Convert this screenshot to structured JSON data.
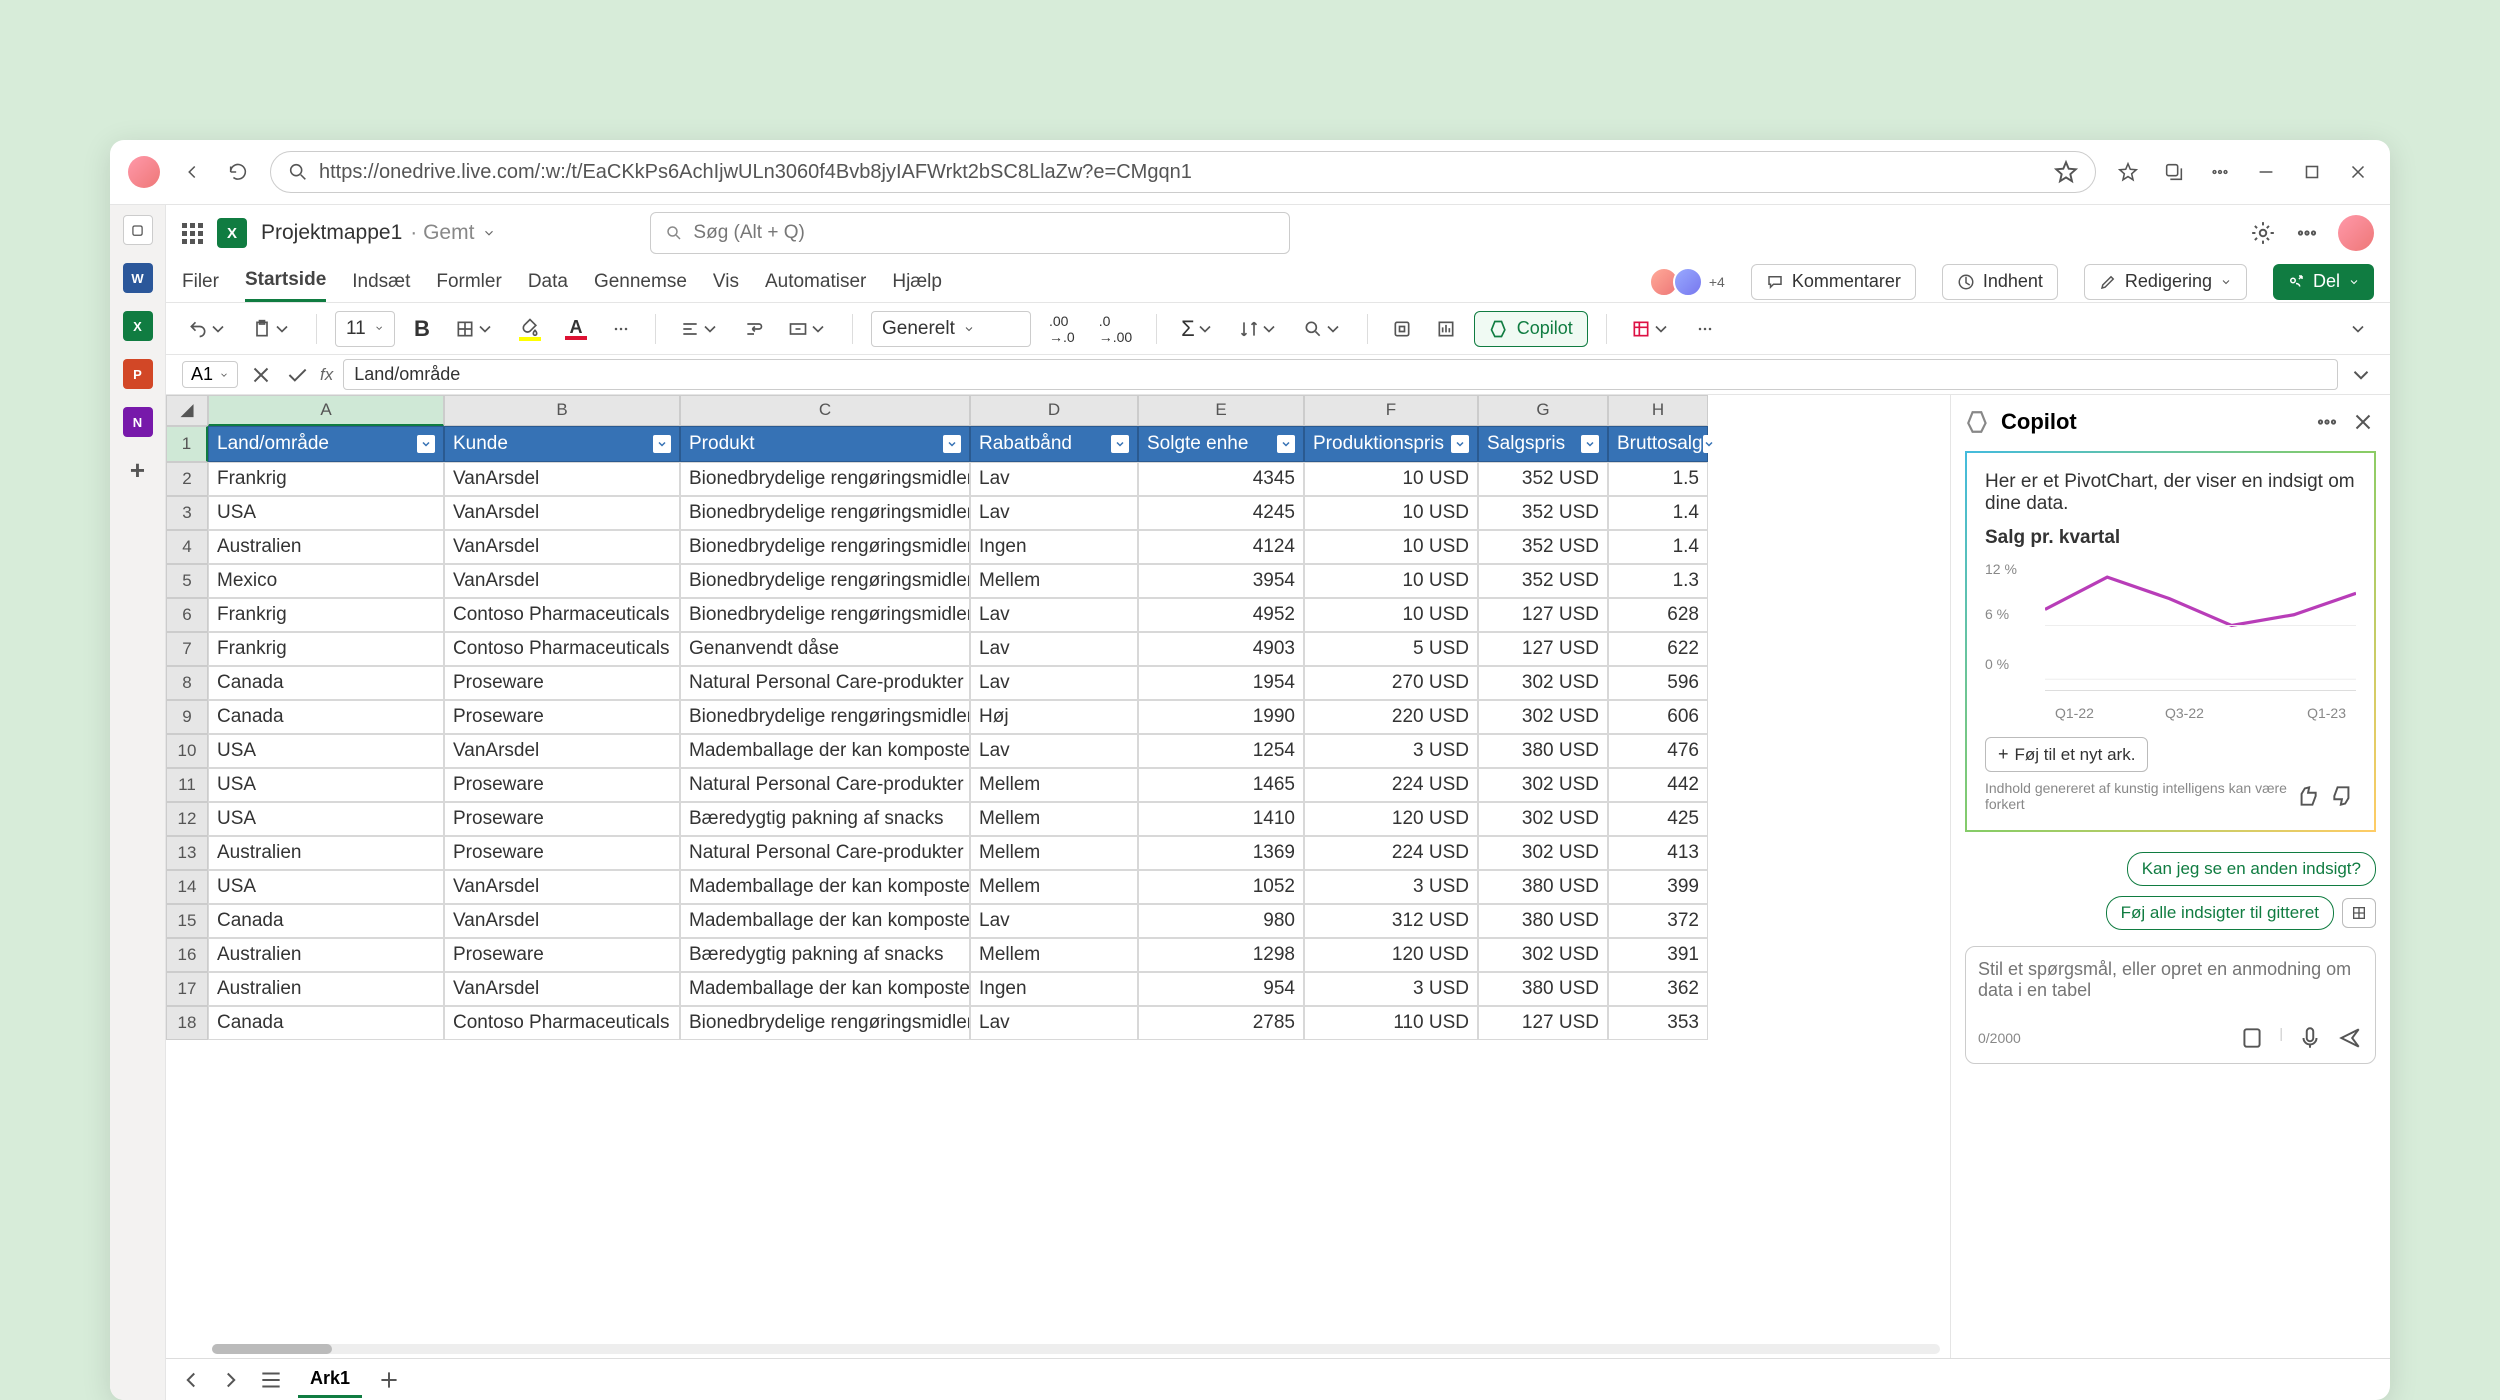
{
  "url": "https://onedrive.live.com/:w:/t/EaCKkPs6AchIjwULn3060f4Bvb8jyIAFWrkt2bSC8LlaZw?e=CMgqn1",
  "doc": {
    "name": "Projektmappe1",
    "state": "Gemt"
  },
  "search_placeholder": "Søg (Alt + Q)",
  "tabs": [
    "Filer",
    "Startside",
    "Indsæt",
    "Formler",
    "Data",
    "Gennemse",
    "Vis",
    "Automatiser",
    "Hjælp"
  ],
  "active_tab": "Startside",
  "more_avatars": "+4",
  "kommentarer": "Kommentarer",
  "indhent": "Indhent",
  "redigering": "Redigering",
  "del": "Del",
  "toolbar": {
    "font_size": "11",
    "number_format": "Generelt",
    "copilot": "Copilot"
  },
  "namebox": "A1",
  "formula": "Land/område",
  "col_headers": [
    "A",
    "B",
    "C",
    "D",
    "E",
    "F",
    "G",
    "H"
  ],
  "table": {
    "headers": [
      "Land/område",
      "Kunde",
      "Produkt",
      "Rabatbånd",
      "Solgte enhe",
      "Produktionspris",
      "Salgspris",
      "Bruttosalg"
    ],
    "rows": [
      [
        "Frankrig",
        "VanArsdel",
        "Bionedbrydelige rengøringsmidler",
        "Lav",
        "4345",
        "10 USD",
        "352 USD",
        "1.5"
      ],
      [
        "USA",
        "VanArsdel",
        "Bionedbrydelige rengøringsmidler",
        "Lav",
        "4245",
        "10 USD",
        "352 USD",
        "1.4"
      ],
      [
        "Australien",
        "VanArsdel",
        "Bionedbrydelige rengøringsmidler",
        "Ingen",
        "4124",
        "10 USD",
        "352 USD",
        "1.4"
      ],
      [
        "Mexico",
        "VanArsdel",
        "Bionedbrydelige rengøringsmidler",
        "Mellem",
        "3954",
        "10 USD",
        "352 USD",
        "1.3"
      ],
      [
        "Frankrig",
        "Contoso Pharmaceuticals",
        "Bionedbrydelige rengøringsmidler",
        "Lav",
        "4952",
        "10 USD",
        "127 USD",
        "628"
      ],
      [
        "Frankrig",
        "Contoso Pharmaceuticals",
        "Genanvendt dåse",
        "Lav",
        "4903",
        "5 USD",
        "127 USD",
        "622"
      ],
      [
        "Canada",
        "Proseware",
        "Natural Personal Care-produkter",
        "Lav",
        "1954",
        "270 USD",
        "302 USD",
        "596"
      ],
      [
        "Canada",
        "Proseware",
        "Bionedbrydelige rengøringsmidler",
        "Høj",
        "1990",
        "220 USD",
        "302 USD",
        "606"
      ],
      [
        "USA",
        "VanArsdel",
        "Mademballage der kan komposter",
        "Lav",
        "1254",
        "3 USD",
        "380 USD",
        "476"
      ],
      [
        "USA",
        "Proseware",
        "Natural Personal Care-produkter",
        "Mellem",
        "1465",
        "224 USD",
        "302 USD",
        "442"
      ],
      [
        "USA",
        "Proseware",
        "Bæredygtig pakning af snacks",
        "Mellem",
        "1410",
        "120 USD",
        "302 USD",
        "425"
      ],
      [
        "Australien",
        "Proseware",
        "Natural Personal Care-produkter",
        "Mellem",
        "1369",
        "224 USD",
        "302 USD",
        "413"
      ],
      [
        "USA",
        "VanArsdel",
        "Mademballage der kan komposter",
        "Mellem",
        "1052",
        "3 USD",
        "380 USD",
        "399"
      ],
      [
        "Canada",
        "VanArsdel",
        "Mademballage der kan komposter",
        "Lav",
        "980",
        "312 USD",
        "380 USD",
        "372"
      ],
      [
        "Australien",
        "Proseware",
        "Bæredygtig pakning af snacks",
        "Mellem",
        "1298",
        "120 USD",
        "302 USD",
        "391"
      ],
      [
        "Australien",
        "VanArsdel",
        "Mademballage der kan komposter",
        "Ingen",
        "954",
        "3 USD",
        "380 USD",
        "362"
      ],
      [
        "Canada",
        "Contoso Pharmaceuticals",
        "Bionedbrydelige rengøringsmidler",
        "Lav",
        "2785",
        "110 USD",
        "127 USD",
        "353"
      ]
    ]
  },
  "sheet_tab": "Ark1",
  "copilot": {
    "title": "Copilot",
    "intro": "Her er et PivotChart, der viser en indsigt om dine data.",
    "chart_title": "Salg pr. kvartal",
    "add_sheet": "Føj til et nyt ark.",
    "disclaimer": "Indhold genereret af kunstig intelligens kan være forkert",
    "sug1": "Kan jeg se en anden indsigt?",
    "sug2": "Føj alle indsigter til gitteret",
    "input_placeholder": "Stil et spørgsmål, eller opret en anmodning om data i en tabel",
    "counter": "0/2000"
  },
  "chart_data": {
    "type": "line",
    "title": "Salg pr. kvartal",
    "categories": [
      "Q1-22",
      "Q3-22",
      "Q1-23"
    ],
    "yticks": [
      "12 %",
      "6 %",
      "0 %"
    ],
    "series": [
      {
        "name": "Salg",
        "values": [
          9,
          12,
          10,
          8,
          9,
          11
        ]
      }
    ],
    "ylim": [
      0,
      12
    ]
  }
}
